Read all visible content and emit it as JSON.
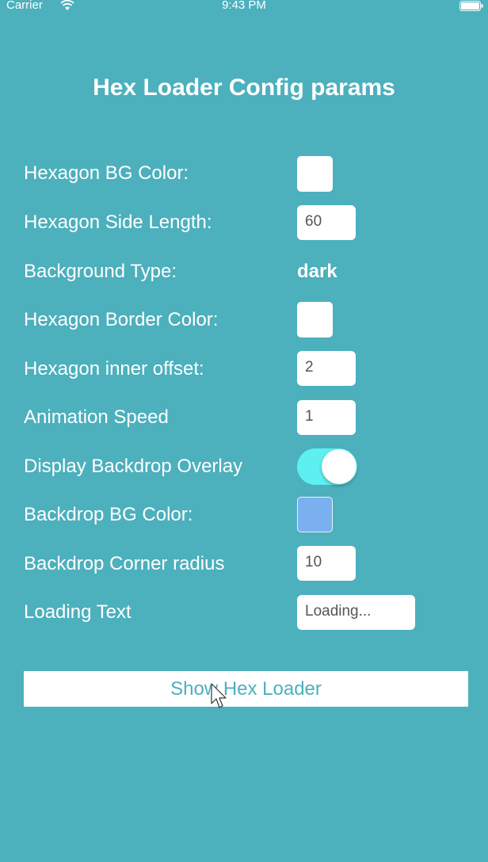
{
  "status_bar": {
    "carrier": "Carrier",
    "time": "9:43 PM"
  },
  "title": "Hex Loader Config params",
  "rows": [
    {
      "label": "Hexagon BG Color:",
      "type": "color",
      "color": "#ffffff"
    },
    {
      "label": "Hexagon Side Length:",
      "type": "text",
      "value": "60"
    },
    {
      "label": "Background Type:",
      "type": "value",
      "value": "dark"
    },
    {
      "label": "Hexagon Border Color:",
      "type": "color",
      "color": "#ffffff"
    },
    {
      "label": "Hexagon inner offset:",
      "type": "text",
      "value": "2"
    },
    {
      "label": "Animation Speed",
      "type": "text",
      "value": "1"
    },
    {
      "label": "Display Backdrop Overlay",
      "type": "toggle",
      "on": true
    },
    {
      "label": "Backdrop BG Color:",
      "type": "color",
      "color": "#7ab0f0"
    },
    {
      "label": "Backdrop Corner radius",
      "type": "text",
      "value": "10"
    },
    {
      "label": "Loading Text",
      "type": "text",
      "value": "Loading..."
    }
  ],
  "show_button": "Show Hex Loader",
  "colors": {
    "background": "#4cb0bd",
    "toggle_on": "#5ef0f0",
    "button_text": "#4cb0bd"
  }
}
